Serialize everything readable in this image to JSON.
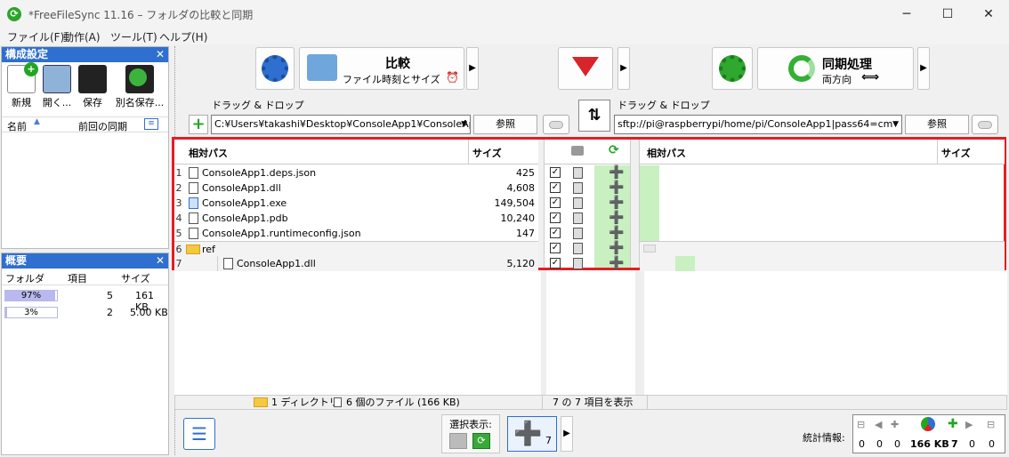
{
  "window": {
    "title": "*FreeFileSync 11.16 – フォルダの比較と同期",
    "min": "─",
    "max": "☐",
    "close": "✕"
  },
  "menu": [
    "ファイル(F)",
    "動作(A)",
    "ツール(T)",
    "ヘルプ(H)"
  ],
  "config_panel": {
    "title": "構成設定",
    "buttons": [
      "新規",
      "開く...",
      "保存",
      "別名保存..."
    ],
    "columns": {
      "name": "名前",
      "last_sync": "前回の同期"
    }
  },
  "summary_panel": {
    "title": "概要",
    "columns": {
      "folder": "フォルダ",
      "items": "項目",
      "size": "サイズ"
    },
    "rows": [
      {
        "percent_label": "97%",
        "fraction": 0.97,
        "items": "5",
        "size": "161 KB"
      },
      {
        "percent_label": "3%",
        "fraction": 0.03,
        "items": "2",
        "size": "5.00 KB"
      }
    ]
  },
  "toolbar": {
    "compare_title": "比較",
    "compare_sub": "ファイル時刻とサイズ",
    "sync_title": "同期処理",
    "sync_sub": "両方向"
  },
  "left_folder": {
    "drag_label": "ドラッグ & ドロップ",
    "path": "C:¥Users¥takashi¥Desktop¥ConsoleApp1¥ConsoleAp",
    "browse": "参照"
  },
  "right_folder": {
    "drag_label": "ドラッグ & ドロップ",
    "path": "sftp://pi@raspberrypi/home/pi/ConsoleApp1|pass64=cm",
    "browse": "参照"
  },
  "grid": {
    "left_headers": {
      "path": "相対パス",
      "size": "サイズ"
    },
    "right_headers": {
      "path": "相対パス",
      "size": "サイズ"
    },
    "rows": [
      {
        "num": "1",
        "name": "ConsoleApp1.deps.json",
        "size": "425"
      },
      {
        "num": "2",
        "name": "ConsoleApp1.dll",
        "size": "4,608"
      },
      {
        "num": "3",
        "name": "ConsoleApp1.exe",
        "size": "149,504"
      },
      {
        "num": "4",
        "name": "ConsoleApp1.pdb",
        "size": "10,240"
      },
      {
        "num": "5",
        "name": "ConsoleApp1.runtimeconfig.json",
        "size": "147"
      },
      {
        "num": "6",
        "name": "ref",
        "size": ""
      },
      {
        "num": "7",
        "name": "ConsoleApp1.dll",
        "size": "5,120"
      }
    ]
  },
  "status": {
    "dirs": "1 ディレクトリ",
    "files": "6 個のファイル (166 KB)",
    "shown": "7 の 7 項目を表示"
  },
  "bottom": {
    "select_view": "選択表示:",
    "create_count": "7",
    "stats_label": "統計情報:",
    "stats": [
      "0",
      "0",
      "0",
      "166 KB",
      "7",
      "0",
      "0"
    ]
  },
  "colors": {
    "accent": "#2f6fcf",
    "highlight": "#e31e24",
    "create_green": "#22a622",
    "row_fill": "#c8f0c0"
  }
}
